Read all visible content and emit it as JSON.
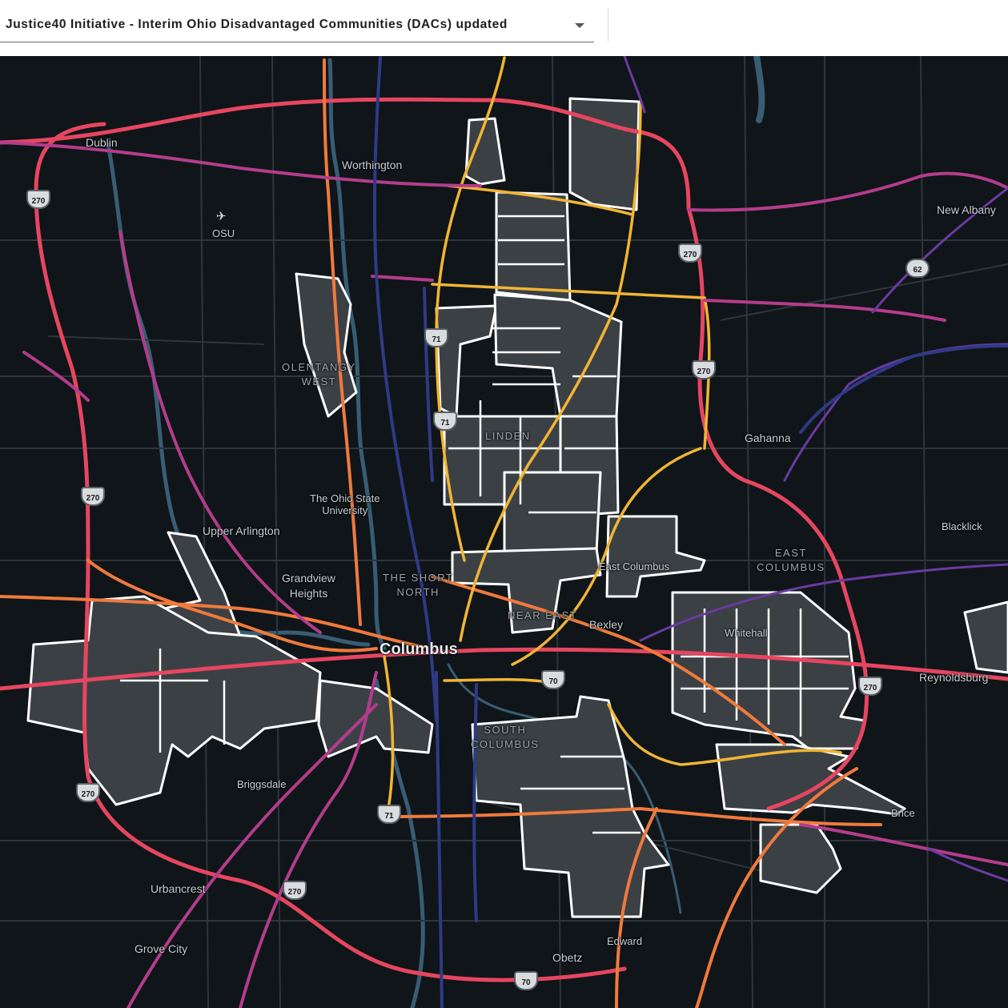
{
  "layer_select": {
    "label": "Justice40 Initiative - Interim Ohio Disadvantaged Communities (DACs) updated",
    "icon": "chevron-down-icon"
  },
  "map": {
    "colors": {
      "background": "#0f1519",
      "water": "#3f6a86",
      "minor_road": "#2e353b",
      "dac_fill": "#3b4045",
      "dac_outline": "#ffffff",
      "traffic_yellow": "#f2b533",
      "traffic_orange": "#f07a3c",
      "traffic_red": "#e64660",
      "traffic_magenta": "#b43c8c",
      "traffic_purple": "#6a3aa0",
      "traffic_navy": "#2f3a86"
    },
    "places": {
      "dublin": "Dublin",
      "worthington": "Worthington",
      "osu": "OSU",
      "new_albany": "New Albany",
      "olentangy_west": "OLENTANGY\nWEST",
      "linden": "LINDEN",
      "gahanna": "Gahanna",
      "ohio_state": "The Ohio State\nUniversity",
      "upper_arlington": "Upper Arlington",
      "grandview": "Grandview\nHeights",
      "short_north": "THE SHORT\nNORTH",
      "east_columbus_city": "East Columbus",
      "east_columbus_district": "EAST\nCOLUMBUS",
      "blacklick": "Blacklick",
      "columbus": "Columbus",
      "near_east": "NEAR EAST",
      "bexley": "Bexley",
      "whitehall": "Whitehall",
      "reynoldsburg": "Reynoldsburg",
      "south_columbus": "SOUTH\nCOLUMBUS",
      "briggsdale": "Briggsdale",
      "brice": "Brice",
      "urbancrest": "Urbancrest",
      "grove_city": "Grove City",
      "edward": "Edward",
      "obetz": "Obetz"
    },
    "shields": [
      "270",
      "270",
      "270",
      "270",
      "270",
      "270",
      "270",
      "71",
      "71",
      "71",
      "70",
      "70",
      "62"
    ]
  }
}
